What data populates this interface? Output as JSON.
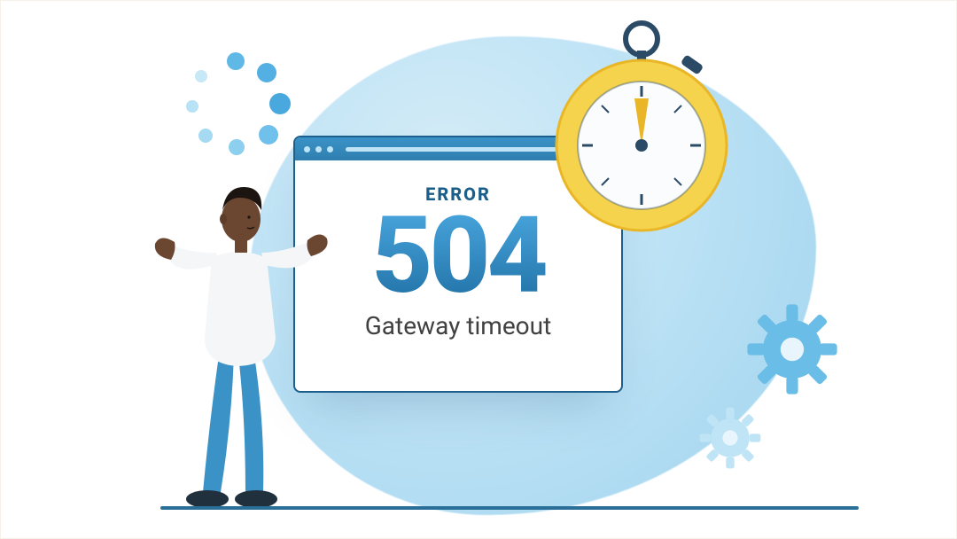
{
  "error": {
    "label": "ERROR",
    "code": "504",
    "message": "Gateway timeout"
  },
  "icons": {
    "spinner": "loading-spinner-icon",
    "stopwatch": "stopwatch-icon",
    "gear_large": "gear-icon",
    "gear_small": "gear-icon",
    "person": "person-shrugging-icon"
  },
  "colors": {
    "accent_dark": "#1c5e8a",
    "accent": "#4aa8e0",
    "blob": "#b5e0f4",
    "gold": "#f4cf4a",
    "skin": "#6b4631",
    "text": "#404040"
  }
}
